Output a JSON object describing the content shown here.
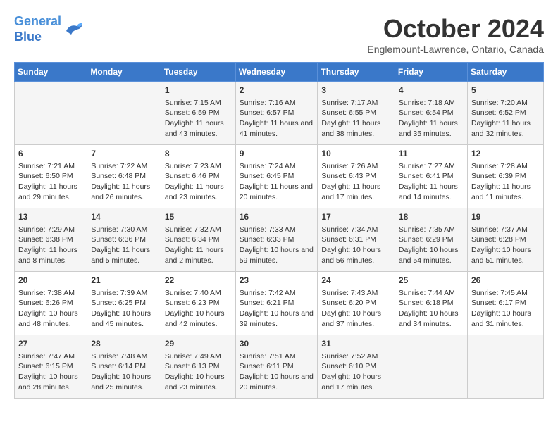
{
  "header": {
    "logo_line1": "General",
    "logo_line2": "Blue",
    "month": "October 2024",
    "location": "Englemount-Lawrence, Ontario, Canada"
  },
  "weekdays": [
    "Sunday",
    "Monday",
    "Tuesday",
    "Wednesday",
    "Thursday",
    "Friday",
    "Saturday"
  ],
  "weeks": [
    [
      {
        "day": "",
        "content": ""
      },
      {
        "day": "",
        "content": ""
      },
      {
        "day": "1",
        "content": "Sunrise: 7:15 AM\nSunset: 6:59 PM\nDaylight: 11 hours and 43 minutes."
      },
      {
        "day": "2",
        "content": "Sunrise: 7:16 AM\nSunset: 6:57 PM\nDaylight: 11 hours and 41 minutes."
      },
      {
        "day": "3",
        "content": "Sunrise: 7:17 AM\nSunset: 6:55 PM\nDaylight: 11 hours and 38 minutes."
      },
      {
        "day": "4",
        "content": "Sunrise: 7:18 AM\nSunset: 6:54 PM\nDaylight: 11 hours and 35 minutes."
      },
      {
        "day": "5",
        "content": "Sunrise: 7:20 AM\nSunset: 6:52 PM\nDaylight: 11 hours and 32 minutes."
      }
    ],
    [
      {
        "day": "6",
        "content": "Sunrise: 7:21 AM\nSunset: 6:50 PM\nDaylight: 11 hours and 29 minutes."
      },
      {
        "day": "7",
        "content": "Sunrise: 7:22 AM\nSunset: 6:48 PM\nDaylight: 11 hours and 26 minutes."
      },
      {
        "day": "8",
        "content": "Sunrise: 7:23 AM\nSunset: 6:46 PM\nDaylight: 11 hours and 23 minutes."
      },
      {
        "day": "9",
        "content": "Sunrise: 7:24 AM\nSunset: 6:45 PM\nDaylight: 11 hours and 20 minutes."
      },
      {
        "day": "10",
        "content": "Sunrise: 7:26 AM\nSunset: 6:43 PM\nDaylight: 11 hours and 17 minutes."
      },
      {
        "day": "11",
        "content": "Sunrise: 7:27 AM\nSunset: 6:41 PM\nDaylight: 11 hours and 14 minutes."
      },
      {
        "day": "12",
        "content": "Sunrise: 7:28 AM\nSunset: 6:39 PM\nDaylight: 11 hours and 11 minutes."
      }
    ],
    [
      {
        "day": "13",
        "content": "Sunrise: 7:29 AM\nSunset: 6:38 PM\nDaylight: 11 hours and 8 minutes."
      },
      {
        "day": "14",
        "content": "Sunrise: 7:30 AM\nSunset: 6:36 PM\nDaylight: 11 hours and 5 minutes."
      },
      {
        "day": "15",
        "content": "Sunrise: 7:32 AM\nSunset: 6:34 PM\nDaylight: 11 hours and 2 minutes."
      },
      {
        "day": "16",
        "content": "Sunrise: 7:33 AM\nSunset: 6:33 PM\nDaylight: 10 hours and 59 minutes."
      },
      {
        "day": "17",
        "content": "Sunrise: 7:34 AM\nSunset: 6:31 PM\nDaylight: 10 hours and 56 minutes."
      },
      {
        "day": "18",
        "content": "Sunrise: 7:35 AM\nSunset: 6:29 PM\nDaylight: 10 hours and 54 minutes."
      },
      {
        "day": "19",
        "content": "Sunrise: 7:37 AM\nSunset: 6:28 PM\nDaylight: 10 hours and 51 minutes."
      }
    ],
    [
      {
        "day": "20",
        "content": "Sunrise: 7:38 AM\nSunset: 6:26 PM\nDaylight: 10 hours and 48 minutes."
      },
      {
        "day": "21",
        "content": "Sunrise: 7:39 AM\nSunset: 6:25 PM\nDaylight: 10 hours and 45 minutes."
      },
      {
        "day": "22",
        "content": "Sunrise: 7:40 AM\nSunset: 6:23 PM\nDaylight: 10 hours and 42 minutes."
      },
      {
        "day": "23",
        "content": "Sunrise: 7:42 AM\nSunset: 6:21 PM\nDaylight: 10 hours and 39 minutes."
      },
      {
        "day": "24",
        "content": "Sunrise: 7:43 AM\nSunset: 6:20 PM\nDaylight: 10 hours and 37 minutes."
      },
      {
        "day": "25",
        "content": "Sunrise: 7:44 AM\nSunset: 6:18 PM\nDaylight: 10 hours and 34 minutes."
      },
      {
        "day": "26",
        "content": "Sunrise: 7:45 AM\nSunset: 6:17 PM\nDaylight: 10 hours and 31 minutes."
      }
    ],
    [
      {
        "day": "27",
        "content": "Sunrise: 7:47 AM\nSunset: 6:15 PM\nDaylight: 10 hours and 28 minutes."
      },
      {
        "day": "28",
        "content": "Sunrise: 7:48 AM\nSunset: 6:14 PM\nDaylight: 10 hours and 25 minutes."
      },
      {
        "day": "29",
        "content": "Sunrise: 7:49 AM\nSunset: 6:13 PM\nDaylight: 10 hours and 23 minutes."
      },
      {
        "day": "30",
        "content": "Sunrise: 7:51 AM\nSunset: 6:11 PM\nDaylight: 10 hours and 20 minutes."
      },
      {
        "day": "31",
        "content": "Sunrise: 7:52 AM\nSunset: 6:10 PM\nDaylight: 10 hours and 17 minutes."
      },
      {
        "day": "",
        "content": ""
      },
      {
        "day": "",
        "content": ""
      }
    ]
  ]
}
